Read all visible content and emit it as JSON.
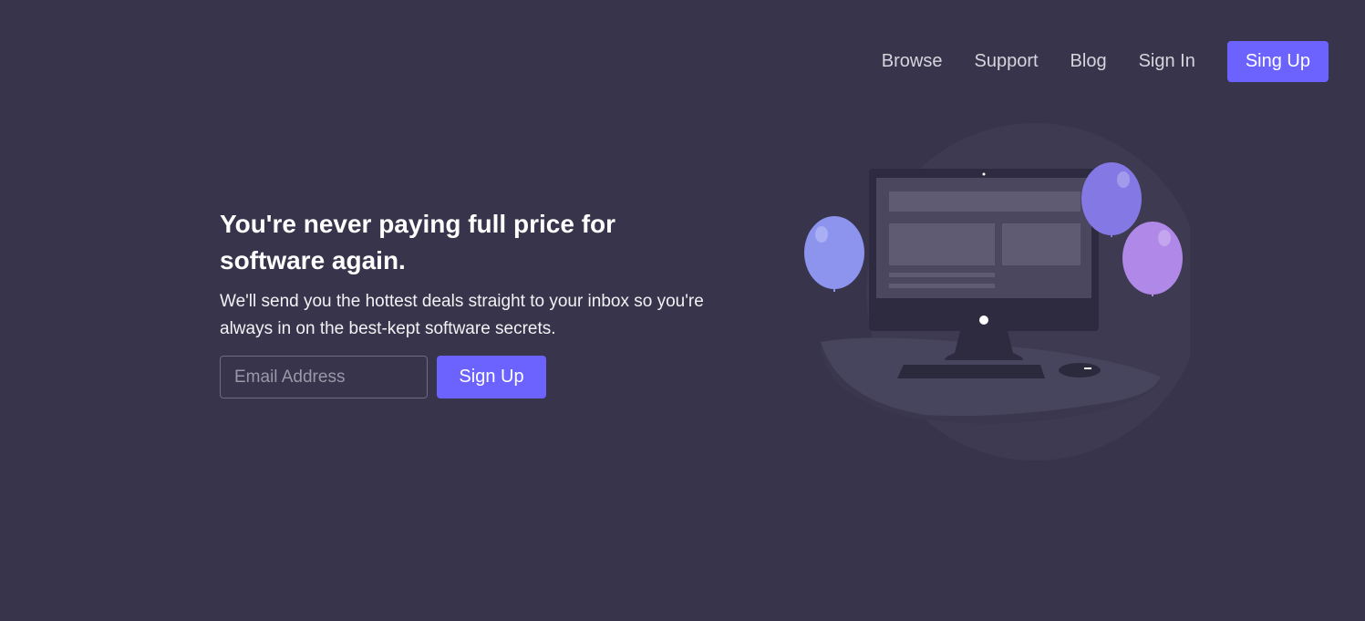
{
  "nav": {
    "links": [
      "Browse",
      "Support",
      "Blog",
      "Sign In"
    ],
    "cta_label": "Sing Up"
  },
  "hero": {
    "title": "You're never paying full price for software again.",
    "subtitle": "We'll send you the hottest deals straight to your inbox so you're always in on the best-kept software secrets.",
    "email_placeholder": "Email Address",
    "signup_label": "Sign Up"
  },
  "illustration": {
    "icon": "computer-with-balloons-illustration"
  },
  "colors": {
    "background": "#37344b",
    "accent": "#6c63ff",
    "balloon_blue": "#8c94ee",
    "balloon_indigo": "#8479e4",
    "balloon_purple": "#b088e8"
  }
}
